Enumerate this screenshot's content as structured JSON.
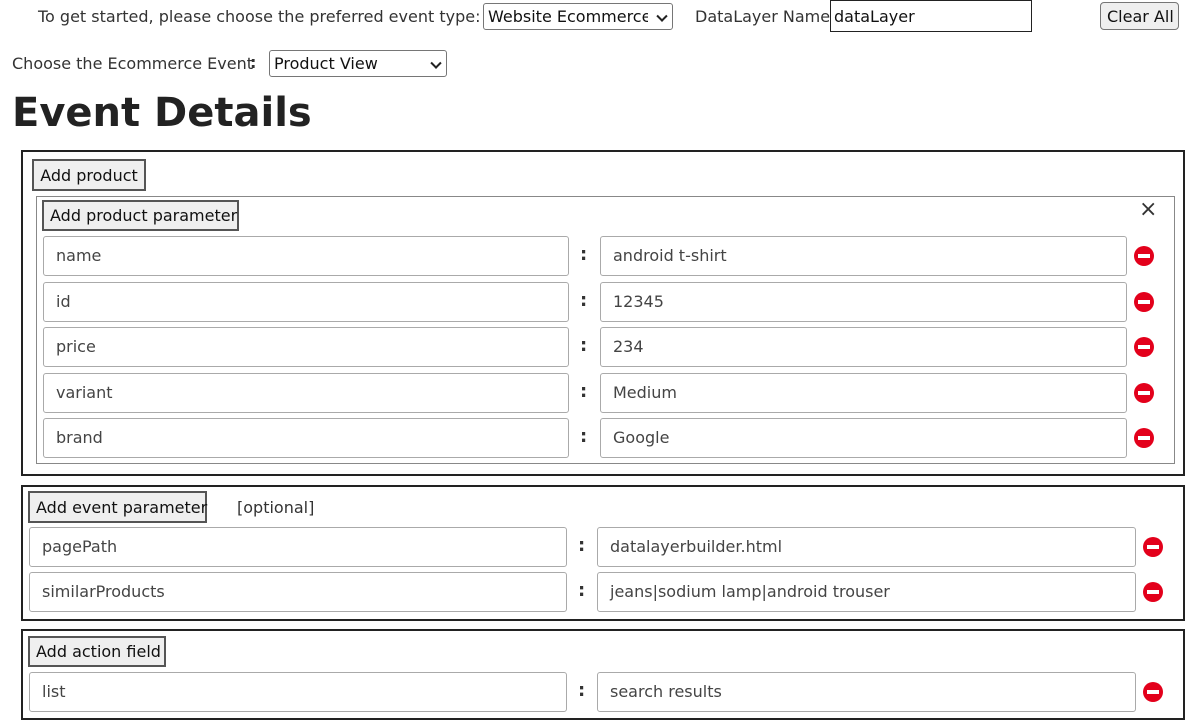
{
  "header": {
    "prompt_label": "To get started, please choose the preferred event type:",
    "event_type_value": "Website Ecommerce",
    "datalayer_label": "DataLayer Name:",
    "datalayer_value": "dataLayer",
    "clear_all": "Clear All",
    "ecommerce_event_label": "Choose the Ecommerce Event",
    "separator": ":",
    "ecommerce_event_value": "Product View"
  },
  "title": "Event Details",
  "product_section": {
    "add_product": "Add product",
    "add_product_parameter": "Add product parameter",
    "close_symbol": "×",
    "params": [
      {
        "key": "name",
        "value": "android t-shirt"
      },
      {
        "key": "id",
        "value": "12345"
      },
      {
        "key": "price",
        "value": "234"
      },
      {
        "key": "variant",
        "value": "Medium"
      },
      {
        "key": "brand",
        "value": "Google"
      }
    ]
  },
  "event_section": {
    "add_event_parameter": "Add event parameter",
    "optional": "[optional]",
    "params": [
      {
        "key": "pagePath",
        "value": "datalayerbuilder.html"
      },
      {
        "key": "similarProducts",
        "value": "jeans|sodium lamp|android trouser"
      }
    ]
  },
  "action_section": {
    "add_action_field": "Add action field",
    "params": [
      {
        "key": "list",
        "value": "search results"
      }
    ]
  },
  "colon": ":",
  "colors": {
    "remove_icon": "#e3001b",
    "border": "#222222"
  }
}
